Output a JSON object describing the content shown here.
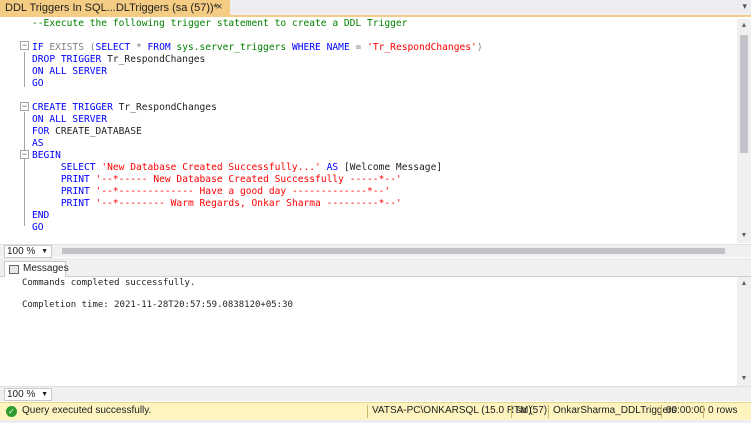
{
  "tab": {
    "title": "DDL Triggers In SQL...DLTriggers (sa (57))*",
    "close_glyph": "×",
    "dropdown_glyph": "▾"
  },
  "editor": {
    "lines": [
      [
        {
          "t": "--Execute the following trigger statement to create a DDL Trigger",
          "c": "cm"
        }
      ],
      [],
      [
        {
          "t": "IF ",
          "c": "kw"
        },
        {
          "t": "EXISTS",
          "c": "gr"
        },
        {
          "t": " (",
          "c": "gr"
        },
        {
          "t": "SELECT",
          "c": "kw"
        },
        {
          "t": " * ",
          "c": "gr"
        },
        {
          "t": "FROM",
          "c": "kw"
        },
        {
          "t": " ",
          "c": "tx"
        },
        {
          "t": "sys.server_triggers",
          "c": "sys"
        },
        {
          "t": " ",
          "c": "tx"
        },
        {
          "t": "WHERE",
          "c": "kw"
        },
        {
          "t": " NAME ",
          "c": "kw"
        },
        {
          "t": "=",
          "c": "gr"
        },
        {
          "t": " ",
          "c": "tx"
        },
        {
          "t": "'Tr_RespondChanges'",
          "c": "str"
        },
        {
          "t": ")",
          "c": "gr"
        }
      ],
      [
        {
          "t": "DROP TRIGGER",
          "c": "kw"
        },
        {
          "t": " Tr_RespondChanges",
          "c": "tx"
        }
      ],
      [
        {
          "t": "ON ALL SERVER",
          "c": "kw"
        }
      ],
      [
        {
          "t": "GO",
          "c": "kw"
        }
      ],
      [],
      [
        {
          "t": "CREATE TRIGGER",
          "c": "kw"
        },
        {
          "t": " Tr_RespondChanges",
          "c": "tx"
        }
      ],
      [
        {
          "t": "ON ALL SERVER",
          "c": "kw"
        }
      ],
      [
        {
          "t": "FOR",
          "c": "kw"
        },
        {
          "t": " CREATE_DATABASE",
          "c": "tx"
        }
      ],
      [
        {
          "t": "AS",
          "c": "kw"
        }
      ],
      [
        {
          "t": "BEGIN",
          "c": "kw"
        }
      ],
      [
        {
          "t": "     ",
          "c": "tx"
        },
        {
          "t": "SELECT",
          "c": "kw"
        },
        {
          "t": " ",
          "c": "tx"
        },
        {
          "t": "'New Database Created Successfully...'",
          "c": "str"
        },
        {
          "t": " ",
          "c": "tx"
        },
        {
          "t": "AS",
          "c": "kw"
        },
        {
          "t": " [Welcome Message]",
          "c": "tx"
        }
      ],
      [
        {
          "t": "     ",
          "c": "tx"
        },
        {
          "t": "PRINT",
          "c": "kw"
        },
        {
          "t": " ",
          "c": "tx"
        },
        {
          "t": "'--*----- New Database Created Successfully -----*--'",
          "c": "str"
        }
      ],
      [
        {
          "t": "     ",
          "c": "tx"
        },
        {
          "t": "PRINT",
          "c": "kw"
        },
        {
          "t": " ",
          "c": "tx"
        },
        {
          "t": "'--*------------- Have a good day -------------*--'",
          "c": "str"
        }
      ],
      [
        {
          "t": "     ",
          "c": "tx"
        },
        {
          "t": "PRINT",
          "c": "kw"
        },
        {
          "t": " ",
          "c": "tx"
        },
        {
          "t": "'--*-------- Warm Regards, Onkar Sharma ---------*--'",
          "c": "str"
        }
      ],
      [
        {
          "t": "END",
          "c": "kw"
        }
      ],
      [
        {
          "t": "GO",
          "c": "kw"
        }
      ]
    ],
    "zoom": "100 %"
  },
  "results": {
    "tab_label": "Messages",
    "messages": [
      "Commands completed successfully.",
      "",
      "Completion time: 2021-11-28T20:57:59.0838120+05:30"
    ],
    "zoom": "100 %"
  },
  "status": {
    "message": "Query executed successfully.",
    "server": "VATSA-PC\\ONKARSQL (15.0 RTM)",
    "user": "sa (57)",
    "database": "OnkarSharma_DDLTriggers",
    "elapsed": "00:00:00",
    "rows": "0 rows",
    "ok_glyph": "✓",
    "status_color": "#fdf4bf"
  }
}
